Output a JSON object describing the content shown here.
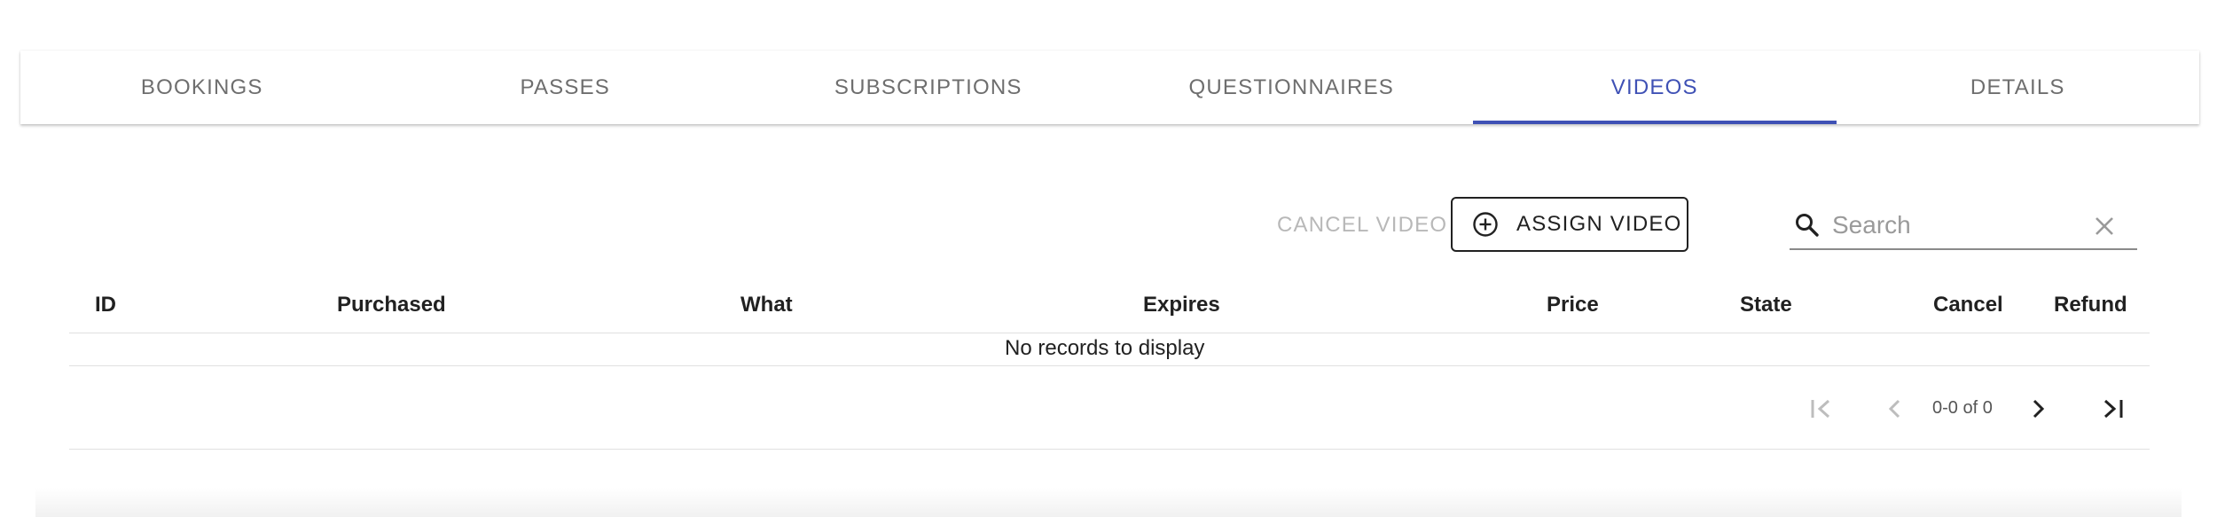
{
  "tabs": [
    {
      "label": "BOOKINGS",
      "active": false
    },
    {
      "label": "PASSES",
      "active": false
    },
    {
      "label": "SUBSCRIPTIONS",
      "active": false
    },
    {
      "label": "QUESTIONNAIRES",
      "active": false
    },
    {
      "label": "VIDEOS",
      "active": true
    },
    {
      "label": "DETAILS",
      "active": false
    }
  ],
  "toolbar": {
    "cancel_label": "CANCEL VIDEO",
    "assign_label": "ASSIGN VIDEO",
    "assign_icon": "add-circle-icon"
  },
  "search": {
    "placeholder": "Search",
    "value": "",
    "icon": "search-icon",
    "clear_icon": "close-icon"
  },
  "table": {
    "columns": [
      "ID",
      "Purchased",
      "What",
      "Expires",
      "Price",
      "State",
      "Cancel",
      "Refund"
    ],
    "empty_message": "No records to display"
  },
  "pagination": {
    "range_text": "0-0 of 0",
    "first_icon": "first-page-icon",
    "prev_icon": "chevron-left-icon",
    "next_icon": "chevron-right-icon",
    "last_icon": "last-page-icon"
  },
  "colors": {
    "accent": "#3f51b5",
    "disabled": "#b8b8b8",
    "tab_text": "#6e6e6e"
  }
}
